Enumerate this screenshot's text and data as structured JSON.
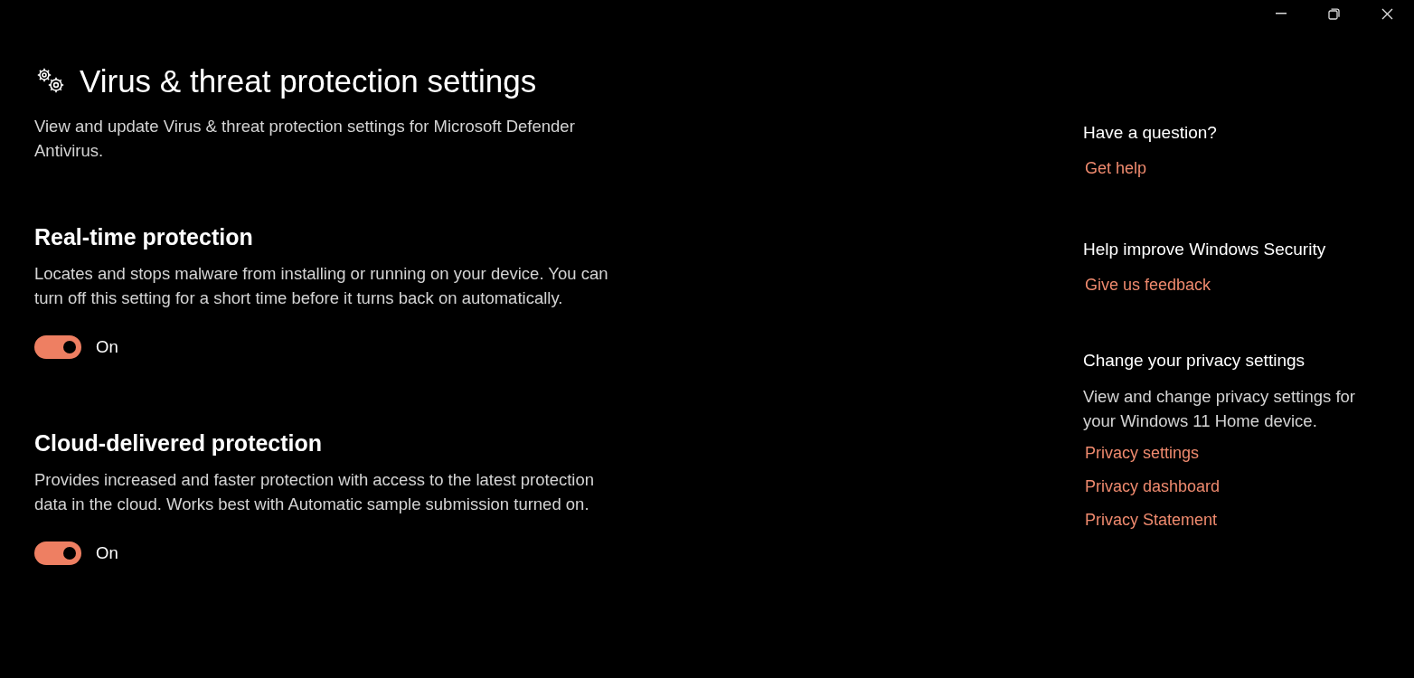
{
  "window": {
    "controls": [
      {
        "kind": "minimize"
      },
      {
        "kind": "restore"
      },
      {
        "kind": "close"
      }
    ]
  },
  "page": {
    "title": "Virus & threat protection settings",
    "description": "View and update Virus & threat protection settings for Microsoft Defender Antivirus."
  },
  "settings": [
    {
      "heading": "Real-time protection",
      "description": "Locates and stops malware from installing or running on your device. You can turn off this setting for a short time before it turns back on automatically.",
      "on": true,
      "state_label": "On"
    },
    {
      "heading": "Cloud-delivered protection",
      "description": "Provides increased and faster protection with access to the latest protection data in the cloud. Works best with Automatic sample submission turned on.",
      "on": true,
      "state_label": "On"
    }
  ],
  "sidebar": [
    {
      "heading": "Have a question?",
      "links": [
        "Get help"
      ]
    },
    {
      "heading": "Help improve Windows Security",
      "links": [
        "Give us feedback"
      ]
    },
    {
      "heading": "Change your privacy settings",
      "description": "View and change privacy settings for your Windows 11 Home device.",
      "links": [
        "Privacy settings",
        "Privacy dashboard",
        "Privacy Statement"
      ]
    }
  ]
}
